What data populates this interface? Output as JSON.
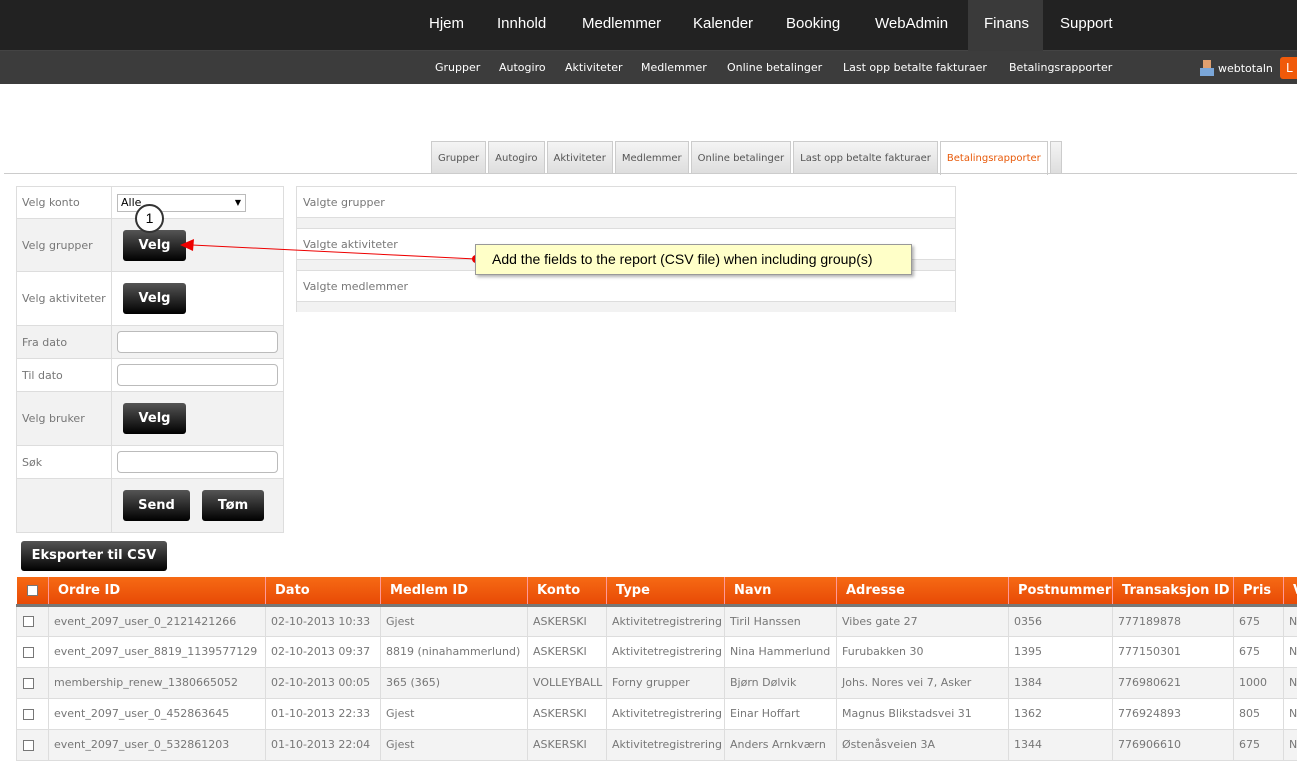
{
  "topnav": [
    "Hjem",
    "Innhold",
    "Medlemmer",
    "Kalender",
    "Booking",
    "WebAdmin",
    "Finans",
    "Support"
  ],
  "subnav": [
    "Grupper",
    "Autogiro",
    "Aktiviteter",
    "Medlemmer",
    "Online betalinger",
    "Last opp betalte fakturaer",
    "Betalingsrapporter"
  ],
  "user": "webtotaln",
  "logout": "L",
  "tabs": [
    "Grupper",
    "Autogiro",
    "Aktiviteter",
    "Medlemmer",
    "Online betalinger",
    "Last opp betalte fakturaer",
    "Betalingsrapporter"
  ],
  "form": {
    "konto_label": "Velg konto",
    "konto_value": "Alle",
    "grupper_label": "Velg grupper",
    "aktiviteter_label": "Velg aktiviteter",
    "fra_label": "Fra dato",
    "til_label": "Til dato",
    "bruker_label": "Velg bruker",
    "sok_label": "Søk",
    "velg": "Velg",
    "send": "Send",
    "tom": "Tøm"
  },
  "panels": [
    "Valgte grupper",
    "Valgte aktiviteter",
    "Valgte medlemmer"
  ],
  "callout": {
    "number": "1",
    "text": "Add the fields to the report (CSV file) when including group(s)"
  },
  "export": "Eksporter til CSV",
  "table": {
    "headers": [
      "Ordre ID",
      "Dato",
      "Medlem ID",
      "Konto",
      "Type",
      "Navn",
      "Adresse",
      "Postnummer",
      "Transaksjon ID",
      "Pris",
      "V"
    ],
    "rows": [
      [
        "event_2097_user_0_2121421266",
        "02-10-2013 10:33",
        "Gjest",
        "ASKERSKI",
        "Aktivitetregistrering",
        "Tiril Hanssen",
        "Vibes gate 27",
        "0356",
        "777189878",
        "675",
        "NO"
      ],
      [
        "event_2097_user_8819_1139577129",
        "02-10-2013 09:37",
        "8819 (ninahammerlund)",
        "ASKERSKI",
        "Aktivitetregistrering",
        "Nina Hammerlund",
        "Furubakken 30",
        "1395",
        "777150301",
        "675",
        "NO"
      ],
      [
        "membership_renew_1380665052",
        "02-10-2013 00:05",
        "365 (365)",
        "VOLLEYBALL",
        "Forny grupper",
        "Bjørn Dølvik",
        "Johs. Nores vei 7, Asker",
        "1384",
        "776980621",
        "1000",
        "NO"
      ],
      [
        "event_2097_user_0_452863645",
        "01-10-2013 22:33",
        "Gjest",
        "ASKERSKI",
        "Aktivitetregistrering",
        "Einar Hoffart",
        "Magnus Blikstadsvei 31",
        "1362",
        "776924893",
        "805",
        "NO"
      ],
      [
        "event_2097_user_0_532861203",
        "01-10-2013 22:04",
        "Gjest",
        "ASKERSKI",
        "Aktivitetregistrering",
        "Anders Arnkværn",
        "Østenåsveien 3A",
        "1344",
        "776906610",
        "675",
        "NO"
      ]
    ]
  }
}
